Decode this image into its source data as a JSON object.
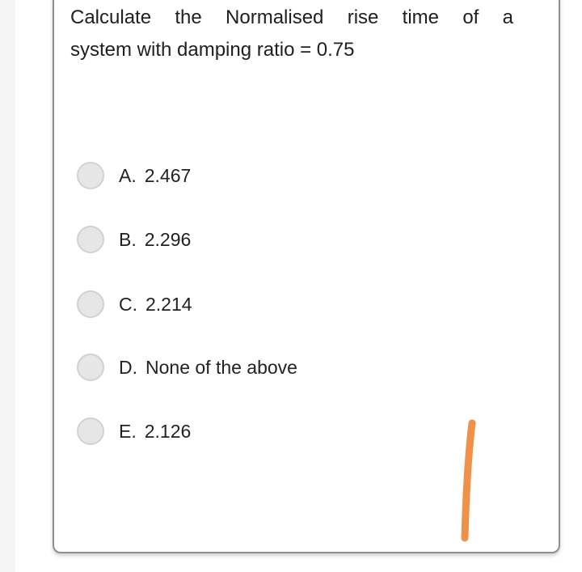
{
  "question": {
    "line1": "Calculate the Normalised rise time of a",
    "line2": "system with damping ratio = 0.75"
  },
  "options": [
    {
      "letter": "A.",
      "value": "2.467",
      "selected": false
    },
    {
      "letter": "B.",
      "value": "2.296",
      "selected": false
    },
    {
      "letter": "C.",
      "value": "2.214",
      "selected": false
    },
    {
      "letter": "D.",
      "value": "None of the above",
      "selected": false
    },
    {
      "letter": "E.",
      "value": "2.126",
      "selected": false
    }
  ],
  "annotation": {
    "type": "handwritten-mark",
    "color": "#f0914a"
  }
}
